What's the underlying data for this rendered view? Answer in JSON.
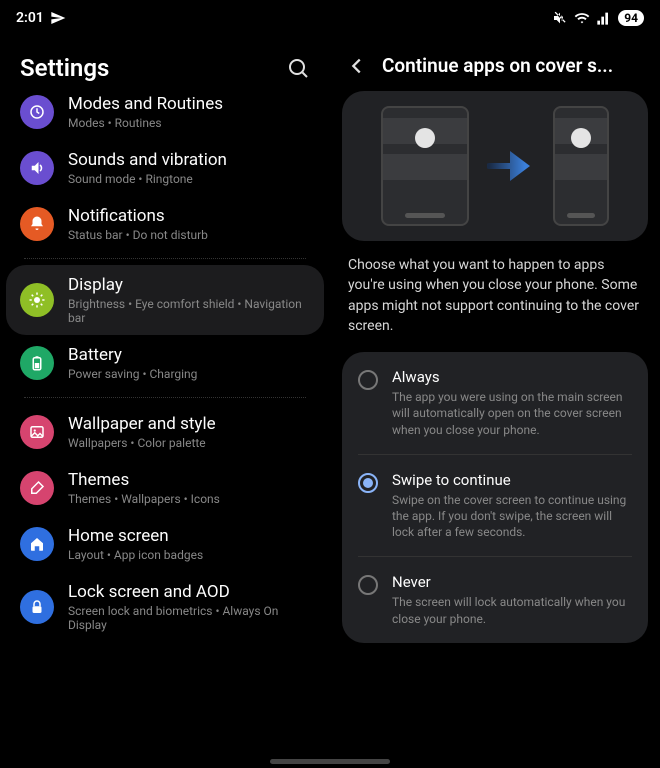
{
  "status": {
    "time": "2:01",
    "battery": "94"
  },
  "left": {
    "title": "Settings",
    "items": [
      {
        "title": "Modes and Routines",
        "sub": "Modes  •  Routines",
        "color": "#6a4ed0",
        "icon": "modes"
      },
      {
        "title": "Sounds and vibration",
        "sub": "Sound mode  •  Ringtone",
        "color": "#6a4ed0",
        "icon": "sound"
      },
      {
        "title": "Notifications",
        "sub": "Status bar  •  Do not disturb",
        "color": "#e55a24",
        "icon": "bell"
      },
      {
        "title": "Display",
        "sub": "Brightness  •  Eye comfort shield  •  Navigation bar",
        "color": "#8fbf26",
        "icon": "sun",
        "selected": true
      },
      {
        "title": "Battery",
        "sub": "Power saving  •  Charging",
        "color": "#1fa866",
        "icon": "battery"
      },
      {
        "title": "Wallpaper and style",
        "sub": "Wallpapers  •  Color palette",
        "color": "#d6446f",
        "icon": "picture"
      },
      {
        "title": "Themes",
        "sub": "Themes  •  Wallpapers  •  Icons",
        "color": "#d6446f",
        "icon": "brush"
      },
      {
        "title": "Home screen",
        "sub": "Layout  •  App icon badges",
        "color": "#2f6fe0",
        "icon": "home"
      },
      {
        "title": "Lock screen and AOD",
        "sub": "Screen lock and biometrics  •  Always On Display",
        "color": "#2f6fe0",
        "icon": "lock"
      }
    ]
  },
  "right": {
    "title": "Continue apps on cover s...",
    "description": "Choose what you want to happen to apps you're using when you close your phone. Some apps might not support continuing to the cover screen.",
    "options": [
      {
        "title": "Always",
        "desc": "The app you were using on the main screen will automatically open on the cover screen when you close your phone.",
        "checked": false
      },
      {
        "title": "Swipe to continue",
        "desc": "Swipe on the cover screen to continue using the app. If you don't swipe, the screen will lock after a few seconds.",
        "checked": true
      },
      {
        "title": "Never",
        "desc": "The screen will lock automatically when you close your phone.",
        "checked": false
      }
    ]
  }
}
